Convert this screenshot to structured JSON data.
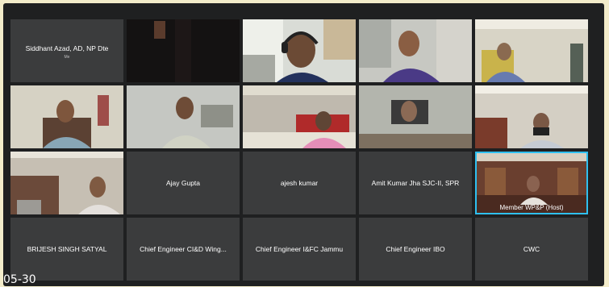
{
  "participants": [
    {
      "name": "Siddhant Azad, AD, NP Dte",
      "sub": "Me"
    },
    {
      "name": ""
    },
    {
      "name": ""
    },
    {
      "name": ""
    },
    {
      "name": ""
    },
    {
      "name": ""
    },
    {
      "name": ""
    },
    {
      "name": ""
    },
    {
      "name": ""
    },
    {
      "name": ""
    },
    {
      "name": ""
    },
    {
      "name": "Ajay Gupta"
    },
    {
      "name": "ajesh kumar"
    },
    {
      "name": "Amit Kumar Jha SJC-II, SPR"
    },
    {
      "name": "Member WP&P  (Host)"
    },
    {
      "name": "BRIJESH SINGH SATYAL"
    },
    {
      "name": "Chief Engineer CI&D Wing..."
    },
    {
      "name": "Chief Engineer I&FC Jammu"
    },
    {
      "name": "Chief Engineer IBO"
    },
    {
      "name": "CWC"
    }
  ],
  "overlay": {
    "date_fragment": "05-30"
  },
  "colors": {
    "active_speaker_border": "#2fc0f0",
    "tile_bg": "#3b3c3d",
    "frame_bg": "#f3ecca"
  }
}
